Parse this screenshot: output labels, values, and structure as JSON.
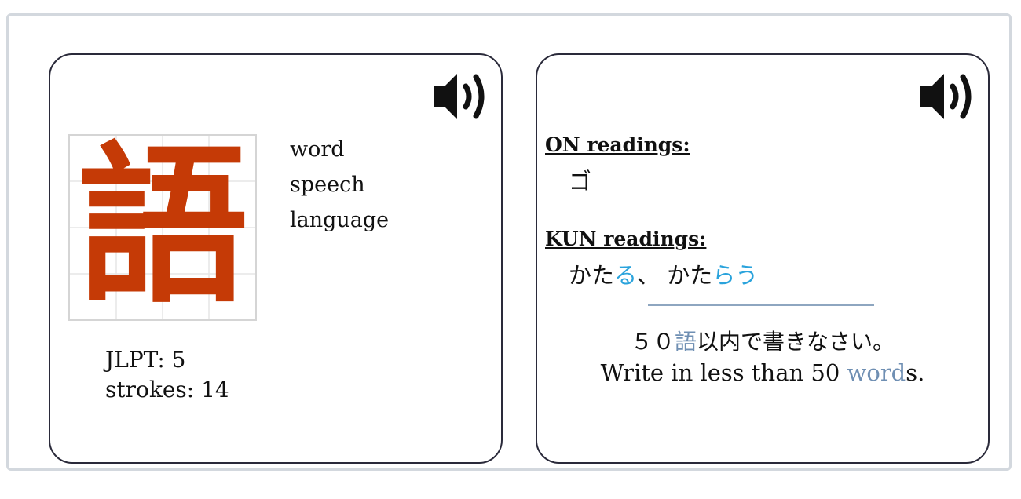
{
  "colors": {
    "kanji": "#c53a06",
    "okurigana": "#2aa3dc",
    "highlight": "#6f8fb3",
    "card_border": "#2a2a3a",
    "frame_border": "#d3d8de"
  },
  "front": {
    "audio_icon": "speaker-icon",
    "kanji": "語",
    "meanings": [
      "word",
      "speech",
      "language"
    ],
    "jlpt": "JLPT: 5",
    "strokes": "strokes: 14"
  },
  "back": {
    "audio_icon": "speaker-icon",
    "on_label": "ON readings:",
    "on_value": "ゴ",
    "kun_label": "KUN readings:",
    "kun_1_stem": "かた",
    "kun_1_okuri": "る",
    "kun_sep": "、 ",
    "kun_2_stem": "かた",
    "kun_2_okuri": "らう",
    "example_ja_pre": "５０",
    "example_ja_hl": "語",
    "example_ja_post": "以内で書きなさい。",
    "example_en_pre": "Write in less than 50 ",
    "example_en_hl": "word",
    "example_en_post": "s."
  }
}
